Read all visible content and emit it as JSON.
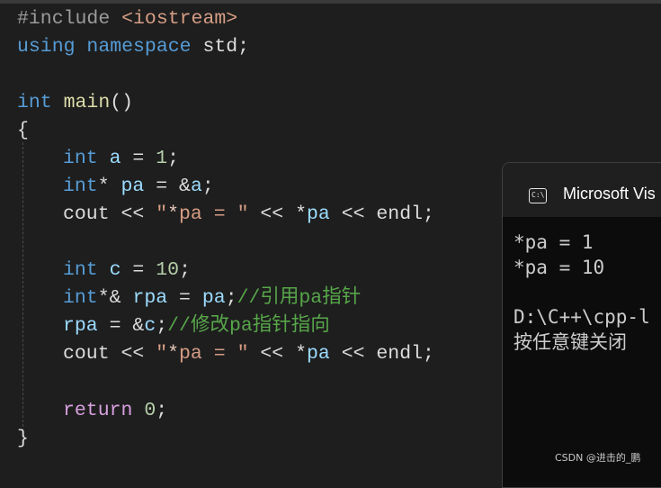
{
  "editor": {
    "lines": {
      "include": {
        "directive": "#include",
        "header": "<iostream>"
      },
      "using": {
        "kw_using": "using",
        "kw_namespace": "namespace",
        "ns": "std",
        "semi": ";"
      },
      "main": {
        "kw_int": "int",
        "name": "main",
        "parens": "()"
      },
      "open_brace": "{",
      "decl_a": {
        "kw": "int",
        "var": "a",
        "op": " = ",
        "val": "1",
        "semi": ";"
      },
      "decl_pa": {
        "kw": "int",
        "star": "*",
        "var": "pa",
        "op": " = &",
        "ref": "a",
        "semi": ";"
      },
      "cout1": {
        "cout": "cout",
        "op1": " << ",
        "q1": "\"",
        "s_star": "*",
        "s_pa": "pa",
        "s_eq": " = ",
        "q2": "\"",
        "op2": " << ",
        "deref": "*",
        "var": "pa",
        "op3": " << ",
        "endl": "endl",
        "semi": ";"
      },
      "decl_c": {
        "kw": "int",
        "var": "c",
        "op": " = ",
        "val": "10",
        "semi": ";"
      },
      "decl_rpa": {
        "kw": "int",
        "sym": "*&",
        "var": "rpa",
        "op": " = ",
        "ref": "pa",
        "semi": ";",
        "comment": "//引用pa指针"
      },
      "assign_rpa": {
        "var": "rpa",
        "op": " = &",
        "ref": "c",
        "semi": ";",
        "comment": "//修改pa指针指向"
      },
      "cout2": {
        "cout": "cout",
        "op1": " << ",
        "q1": "\"",
        "s_star": "*",
        "s_pa": "pa",
        "s_eq": " = ",
        "q2": "\"",
        "op2": " << ",
        "deref": "*",
        "var": "pa",
        "op3": " << ",
        "endl": "endl",
        "semi": ";"
      },
      "return": {
        "kw": "return",
        "val": "0",
        "semi": ";"
      },
      "close_brace": "}"
    }
  },
  "console": {
    "title": "Microsoft Vis",
    "icon_glyph": "C:\\",
    "output": [
      "*pa = 1",
      "*pa = 10",
      "D:\\C++\\cpp-l",
      "按任意键关闭"
    ]
  },
  "watermark": "CSDN @进击的_鹏"
}
